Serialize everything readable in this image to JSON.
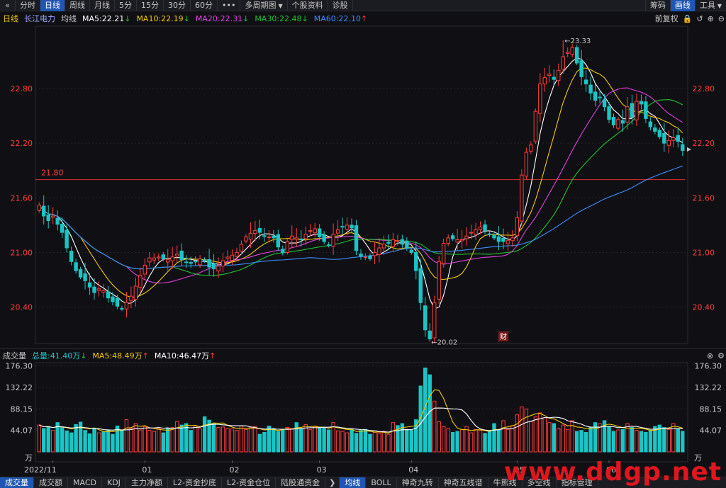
{
  "toolbar": {
    "collapse_icon": "«",
    "periods": [
      "分时",
      "日线",
      "周线",
      "月线",
      "5分",
      "15分",
      "30分",
      "60分"
    ],
    "active_period": 1,
    "more_label": "•••",
    "multi_period_label": "多周期图",
    "stock_info_label": "个股资料",
    "diagnose_label": "诊股",
    "chip_label": "筹码",
    "draw_label": "画线",
    "tools_label": "工具"
  },
  "price_info": {
    "period": "日线",
    "stock_name": "长江电力",
    "ma_label": "均线",
    "ma5": "MA5:22.21",
    "ma10": "MA10:22.19",
    "ma20": "MA20:22.31",
    "ma30": "MA30:22.48",
    "ma60": "MA60:22.10",
    "adjust_label": "前复权"
  },
  "volume_info": {
    "label": "成交量",
    "total": "总量:41.40万",
    "ma5": "MA5:48.49万",
    "ma10": "MA10:46.47万"
  },
  "colors": {
    "up": "#ff3b3b",
    "down": "#19c6c6",
    "ma5": "#ffffff",
    "ma10": "#f0c800",
    "ma20": "#e040e0",
    "ma30": "#22c030",
    "ma60": "#3a8eff",
    "hline": "#c42b2b"
  },
  "chart_data": {
    "type": "candlestick",
    "y_ticks": [
      "22.80",
      "22.20",
      "21.60",
      "21.00",
      "20.40"
    ],
    "y_range": [
      20.0,
      23.5
    ],
    "hline": {
      "value": 21.8,
      "label": "21.80"
    },
    "annotations": [
      {
        "label": "23.33"
      },
      {
        "label": "20.02"
      }
    ],
    "event_marker": "财",
    "x_labels": [
      "2022/11",
      "01",
      "02",
      "03",
      "04",
      "05",
      "06"
    ],
    "vol_ticks": [
      "176.30",
      "132.22",
      "88.15",
      "44.07",
      "万"
    ],
    "vol_range": [
      0,
      180
    ],
    "closes": [
      21.52,
      21.4,
      21.35,
      21.4,
      21.31,
      21.22,
      21.05,
      20.9,
      20.8,
      20.73,
      20.69,
      20.62,
      20.56,
      20.6,
      20.58,
      20.5,
      20.46,
      20.41,
      20.38,
      20.45,
      20.52,
      20.63,
      20.75,
      20.86,
      20.94,
      20.94,
      20.95,
      20.93,
      20.92,
      20.95,
      20.98,
      20.92,
      20.89,
      20.88,
      20.9,
      20.93,
      20.91,
      20.84,
      20.82,
      20.85,
      20.91,
      20.95,
      20.97,
      21.0,
      21.09,
      21.17,
      21.21,
      21.24,
      21.22,
      21.18,
      21.17,
      21.16,
      21.06,
      21.0,
      21.12,
      21.18,
      21.16,
      21.14,
      21.2,
      21.24,
      21.26,
      21.17,
      21.12,
      21.08,
      21.2,
      21.25,
      21.28,
      21.3,
      21.27,
      21.02,
      20.96,
      20.95,
      20.93,
      21.0,
      21.05,
      21.09,
      21.1,
      21.14,
      21.13,
      21.09,
      21.05,
      21.0,
      20.8,
      20.45,
      20.15,
      20.05,
      20.45,
      20.9,
      21.1,
      21.16,
      21.15,
      21.14,
      21.14,
      21.18,
      21.22,
      21.25,
      21.28,
      21.24,
      21.2,
      21.16,
      21.12,
      21.12,
      21.13,
      21.16,
      21.38,
      21.85,
      22.1,
      22.18,
      22.55,
      22.85,
      22.92,
      22.96,
      22.9,
      23.0,
      23.15,
      23.2,
      23.25,
      23.08,
      22.93,
      22.85,
      22.75,
      22.67,
      22.7,
      22.6,
      22.46,
      22.4,
      22.46,
      22.42,
      22.6,
      22.48,
      22.66,
      22.63,
      22.47,
      22.38,
      22.33,
      22.27,
      22.2,
      22.23,
      22.26,
      22.22,
      22.12
    ],
    "volumes": [
      55,
      48,
      52,
      44,
      60,
      50,
      43,
      39,
      56,
      61,
      44,
      37,
      47,
      39,
      41,
      45,
      36,
      53,
      45,
      66,
      48,
      58,
      45,
      52,
      44,
      42,
      48,
      39,
      49,
      50,
      62,
      55,
      58,
      44,
      53,
      48,
      72,
      65,
      58,
      50,
      51,
      48,
      47,
      44,
      53,
      46,
      50,
      52,
      36,
      40,
      53,
      48,
      42,
      45,
      50,
      48,
      60,
      48,
      56,
      46,
      53,
      50,
      49,
      45,
      60,
      43,
      42,
      39,
      47,
      38,
      44,
      46,
      36,
      40,
      38,
      42,
      36,
      60,
      54,
      58,
      46,
      44,
      66,
      135,
      172,
      158,
      104,
      62,
      52,
      48,
      40,
      42,
      46,
      52,
      39,
      46,
      44,
      38,
      42,
      58,
      46,
      64,
      46,
      54,
      76,
      92,
      88,
      62,
      72,
      80,
      70,
      60,
      58,
      48,
      55,
      46,
      64,
      42,
      44,
      40,
      50,
      60,
      58,
      64,
      52,
      42,
      45,
      46,
      58,
      50,
      44,
      42,
      40,
      44,
      52,
      55,
      50,
      46,
      58,
      48,
      42
    ]
  },
  "bottom_tabs": [
    "成交量",
    "成交额",
    "MACD",
    "KDJ",
    "主力净额",
    "L2-资金抄底",
    "L2-资金仓位",
    "陆股通资金"
  ],
  "bottom_tabs_right": [
    "均线",
    "BOLL",
    "神奇九转",
    "神奇五线谱",
    "牛熊线",
    "多空线",
    "指标管理"
  ],
  "watermark": "www.ddgp.net"
}
